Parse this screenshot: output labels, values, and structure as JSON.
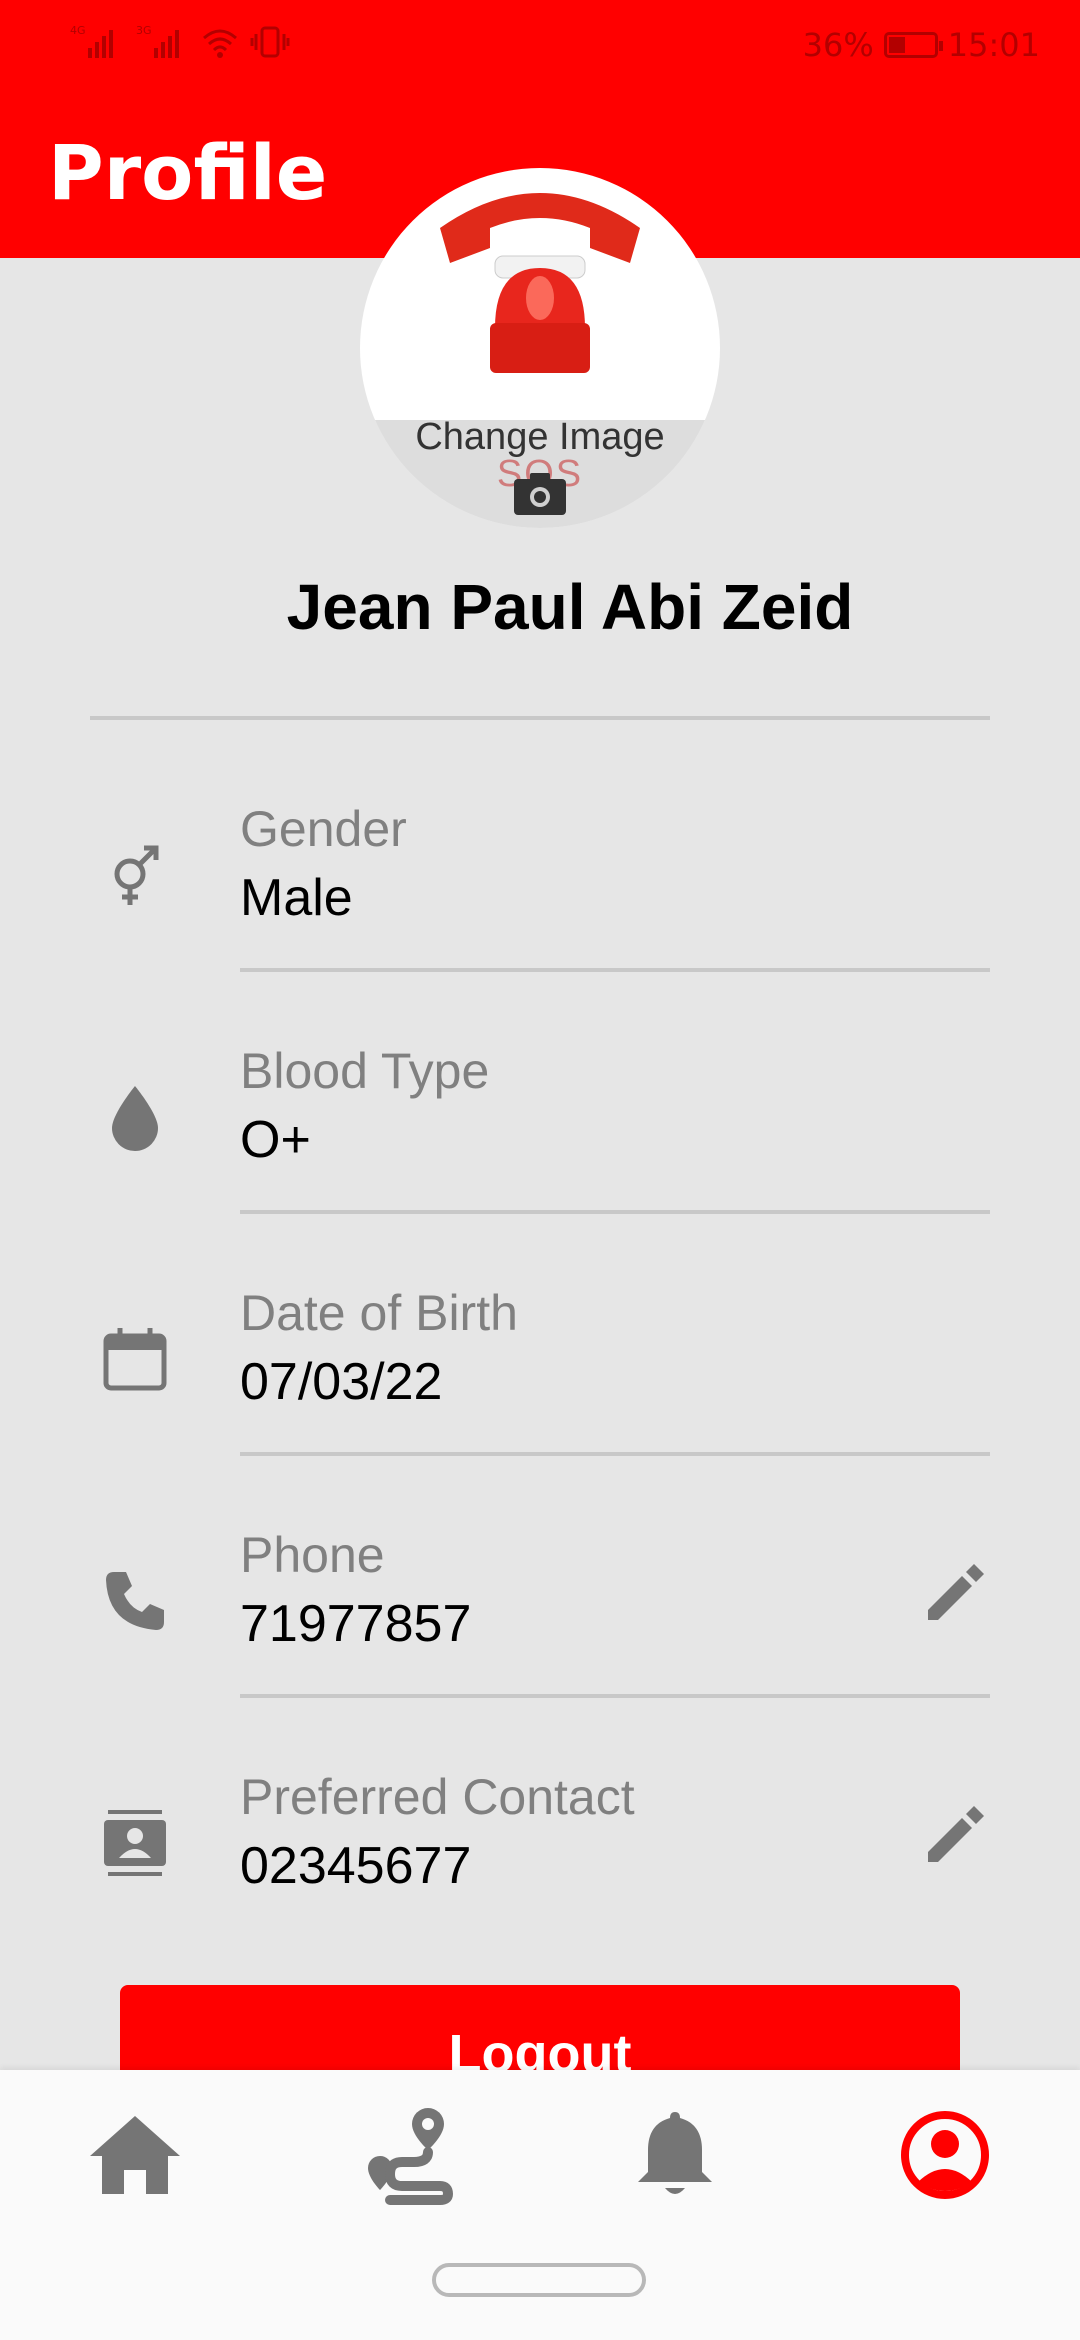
{
  "status_bar": {
    "network_1": "4G",
    "network_2": "3G",
    "battery_percent": "36%",
    "time": "15:01"
  },
  "header": {
    "title": "Profile"
  },
  "avatar": {
    "change_label": "Change Image",
    "image_text": "SOS"
  },
  "user": {
    "name": "Jean Paul Abi Zeid"
  },
  "fields": [
    {
      "label": "Gender",
      "value": "Male",
      "icon": "gender-icon",
      "editable": false
    },
    {
      "label": "Blood Type",
      "value": "O+",
      "icon": "blood-drop-icon",
      "editable": false
    },
    {
      "label": "Date of Birth",
      "value": "07/03/22",
      "icon": "calendar-icon",
      "editable": false
    },
    {
      "label": "Phone",
      "value": "71977857",
      "icon": "phone-icon",
      "editable": true
    },
    {
      "label": "Preferred Contact",
      "value": "02345677",
      "icon": "contact-card-icon",
      "editable": true
    }
  ],
  "logout_label": "Logout",
  "bottom_nav": [
    {
      "name": "home",
      "icon": "home-icon",
      "active": false
    },
    {
      "name": "route",
      "icon": "route-icon",
      "active": false
    },
    {
      "name": "notifications",
      "icon": "bell-icon",
      "active": false
    },
    {
      "name": "profile",
      "icon": "account-circle-icon",
      "active": true
    }
  ],
  "colors": {
    "accent": "#ff0000",
    "icon_gray": "#757575",
    "label_gray": "#808080"
  }
}
